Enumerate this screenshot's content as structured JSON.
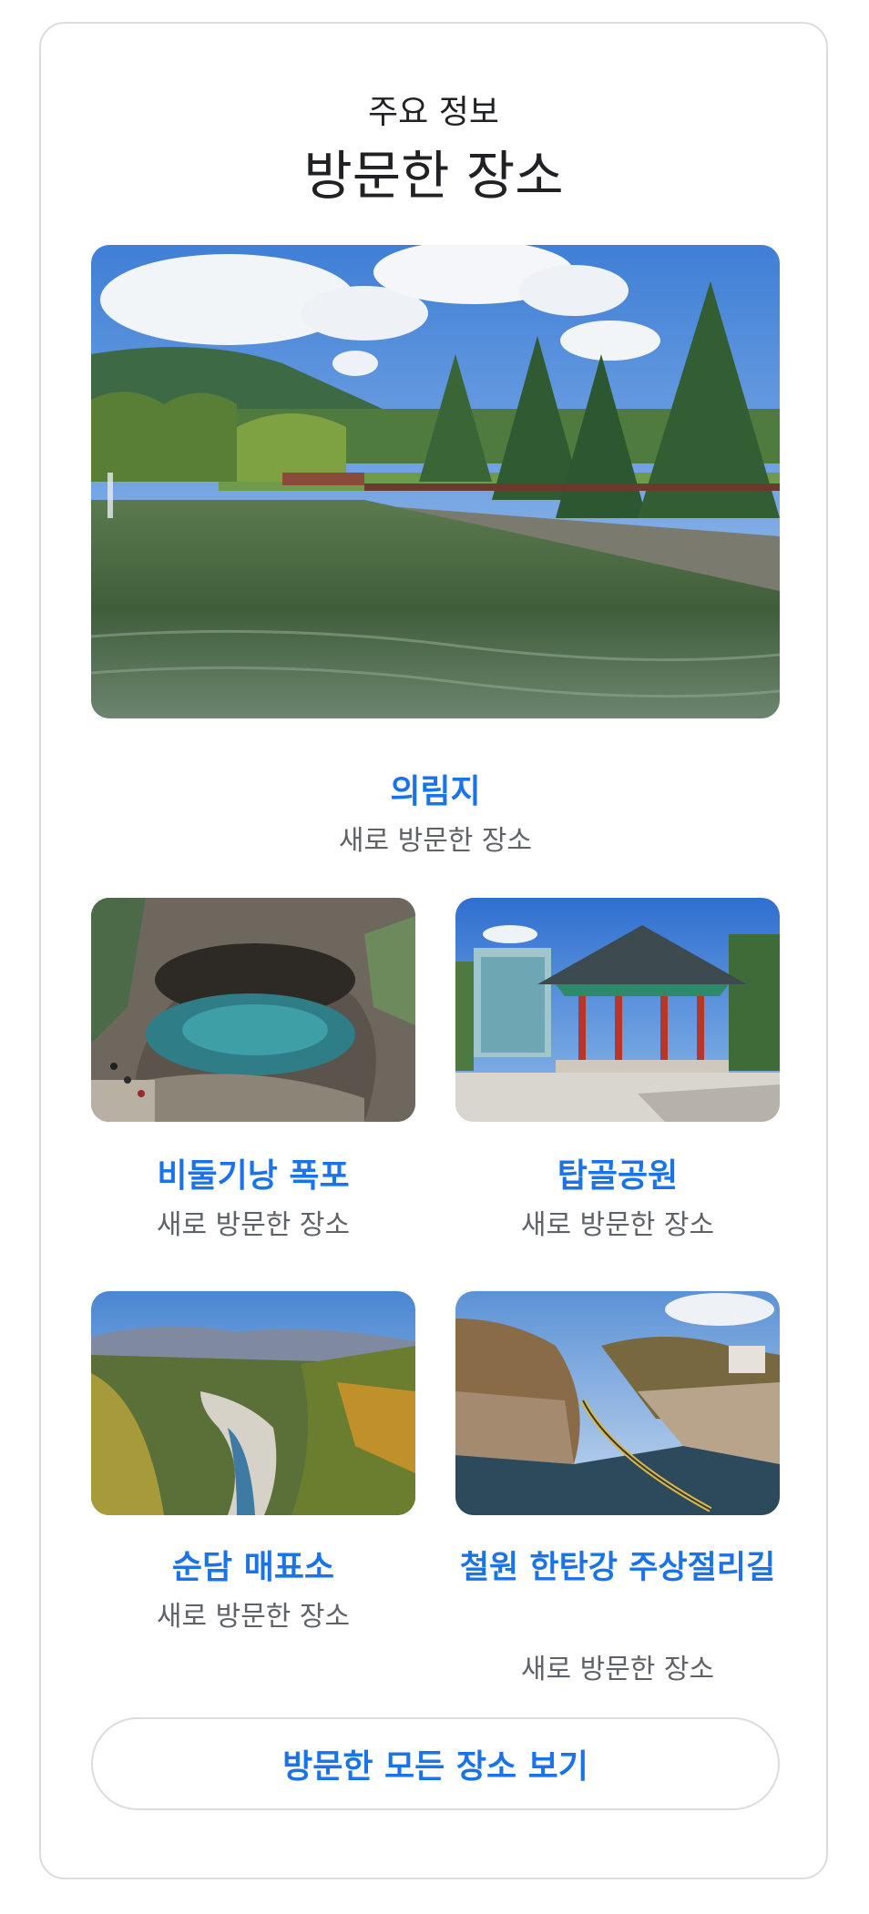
{
  "header": {
    "eyebrow": "주요 정보",
    "title": "방문한 장소"
  },
  "places": [
    {
      "name": "의림지",
      "status": "새로 방문한 장소",
      "image_icon": "lake-photo"
    },
    {
      "name": "비둘기낭 폭포",
      "status": "새로 방문한 장소",
      "image_icon": "waterfall-cave-photo"
    },
    {
      "name": "탑골공원",
      "status": "새로 방문한 장소",
      "image_icon": "pavilion-photo"
    },
    {
      "name": "순담 매표소",
      "status": "새로 방문한 장소",
      "image_icon": "canyon-photo"
    },
    {
      "name": "철원 한탄강 주상절리길",
      "status": "새로 방문한 장소",
      "image_icon": "river-walkway-photo"
    }
  ],
  "view_all_label": "방문한 모든 장소 보기",
  "colors": {
    "accent": "#1a73e8",
    "text_primary": "#202124",
    "text_secondary": "#5f6368",
    "border": "#dadce0"
  }
}
